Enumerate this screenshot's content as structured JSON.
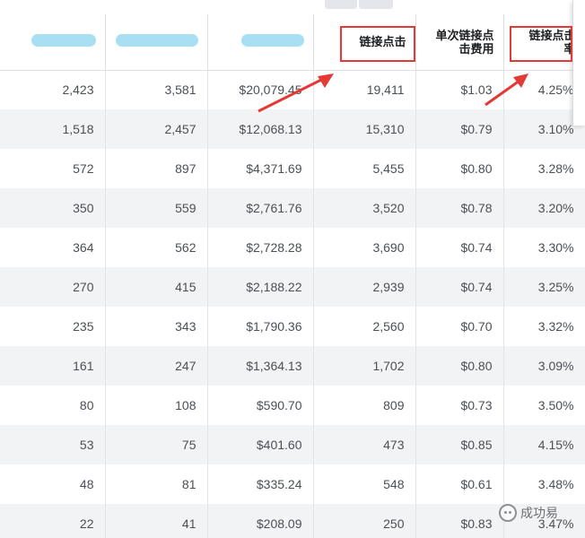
{
  "columns": {
    "col4": "链接点击",
    "col5_line1": "单次链接点",
    "col5_line2": "击费用",
    "col6_line1": "链接点击",
    "col6_line2": "率"
  },
  "rows": [
    {
      "c1": "2,423",
      "c2": "3,581",
      "c3": "$20,079.45",
      "c4": "19,411",
      "c5": "$1.03",
      "c6": "4.25%"
    },
    {
      "c1": "1,518",
      "c2": "2,457",
      "c3": "$12,068.13",
      "c4": "15,310",
      "c5": "$0.79",
      "c6": "3.10%"
    },
    {
      "c1": "572",
      "c2": "897",
      "c3": "$4,371.69",
      "c4": "5,455",
      "c5": "$0.80",
      "c6": "3.28%"
    },
    {
      "c1": "350",
      "c2": "559",
      "c3": "$2,761.76",
      "c4": "3,520",
      "c5": "$0.78",
      "c6": "3.20%"
    },
    {
      "c1": "364",
      "c2": "562",
      "c3": "$2,728.28",
      "c4": "3,690",
      "c5": "$0.74",
      "c6": "3.30%"
    },
    {
      "c1": "270",
      "c2": "415",
      "c3": "$2,188.22",
      "c4": "2,939",
      "c5": "$0.74",
      "c6": "3.25%"
    },
    {
      "c1": "235",
      "c2": "343",
      "c3": "$1,790.36",
      "c4": "2,560",
      "c5": "$0.70",
      "c6": "3.32%"
    },
    {
      "c1": "161",
      "c2": "247",
      "c3": "$1,364.13",
      "c4": "1,702",
      "c5": "$0.80",
      "c6": "3.09%"
    },
    {
      "c1": "80",
      "c2": "108",
      "c3": "$590.70",
      "c4": "809",
      "c5": "$0.73",
      "c6": "3.50%"
    },
    {
      "c1": "53",
      "c2": "75",
      "c3": "$401.60",
      "c4": "473",
      "c5": "$0.85",
      "c6": "4.15%"
    },
    {
      "c1": "48",
      "c2": "81",
      "c3": "$335.24",
      "c4": "548",
      "c5": "$0.61",
      "c6": "3.48%"
    },
    {
      "c1": "22",
      "c2": "41",
      "c3": "$208.09",
      "c4": "250",
      "c5": "$0.83",
      "c6": "3.47%"
    }
  ],
  "watermark": {
    "text": "成功易",
    "icon": "wechat-icon"
  },
  "colors": {
    "highlight": "#e53935",
    "redacted": "#a8dff3",
    "row_alt": "#f2f3f5"
  }
}
